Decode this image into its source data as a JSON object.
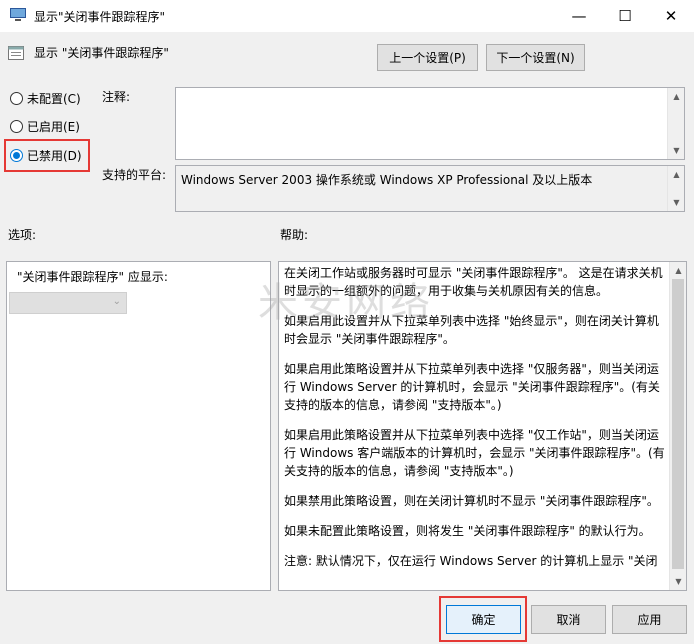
{
  "window": {
    "title": "显示\"关闭事件跟踪程序\"",
    "minimize_glyph": "—",
    "maximize_glyph": "☐",
    "close_glyph": "✕"
  },
  "header": {
    "title": "显示 \"关闭事件跟踪程序\"",
    "prev_setting": "上一个设置(P)",
    "next_setting": "下一个设置(N)"
  },
  "state": {
    "options": [
      {
        "label": "未配置(C)",
        "checked": false
      },
      {
        "label": "已启用(E)",
        "checked": false
      },
      {
        "label": "已禁用(D)",
        "checked": true
      }
    ]
  },
  "comment": {
    "label": "注释:",
    "value": ""
  },
  "platform": {
    "label": "支持的平台:",
    "value": "Windows Server 2003 操作系统或 Windows XP Professional 及以上版本"
  },
  "options_section": {
    "label": "选项:",
    "field_label": "\"关闭事件跟踪程序\" 应显示:",
    "dropdown_value": ""
  },
  "help_section": {
    "label": "帮助:",
    "paragraphs": [
      "在关闭工作站或服务器时可显示 \"关闭事件跟踪程序\"。 这是在请求关机时显示的一组额外的问题，用于收集与关机原因有关的信息。",
      "如果启用此设置并从下拉菜单列表中选择 \"始终显示\"，则在闭关计算机时会显示 \"关闭事件跟踪程序\"。",
      "如果启用此策略设置并从下拉菜单列表中选择 \"仅服务器\"，则当关闭运行 Windows Server 的计算机时，会显示 \"关闭事件跟踪程序\"。(有关支持的版本的信息，请参阅 \"支持版本\"。)",
      "如果启用此策略设置并从下拉菜单列表中选择 \"仅工作站\"，则当关闭运行 Windows 客户端版本的计算机时，会显示 \"关闭事件跟踪程序\"。(有关支持的版本的信息，请参阅 \"支持版本\"。)",
      "如果禁用此策略设置，则在关闭计算机时不显示 \"关闭事件跟踪程序\"。",
      "如果未配置此策略设置，则将发生 \"关闭事件跟踪程序\" 的默认行为。",
      "注意: 默认情况下，仅在运行 Windows Server 的计算机上显示 \"关闭"
    ]
  },
  "footer": {
    "ok": "确定",
    "cancel": "取消",
    "apply": "应用"
  },
  "watermark": "米安网络",
  "colors": {
    "highlight": "#e53935",
    "radio_accent": "#0078d7"
  }
}
